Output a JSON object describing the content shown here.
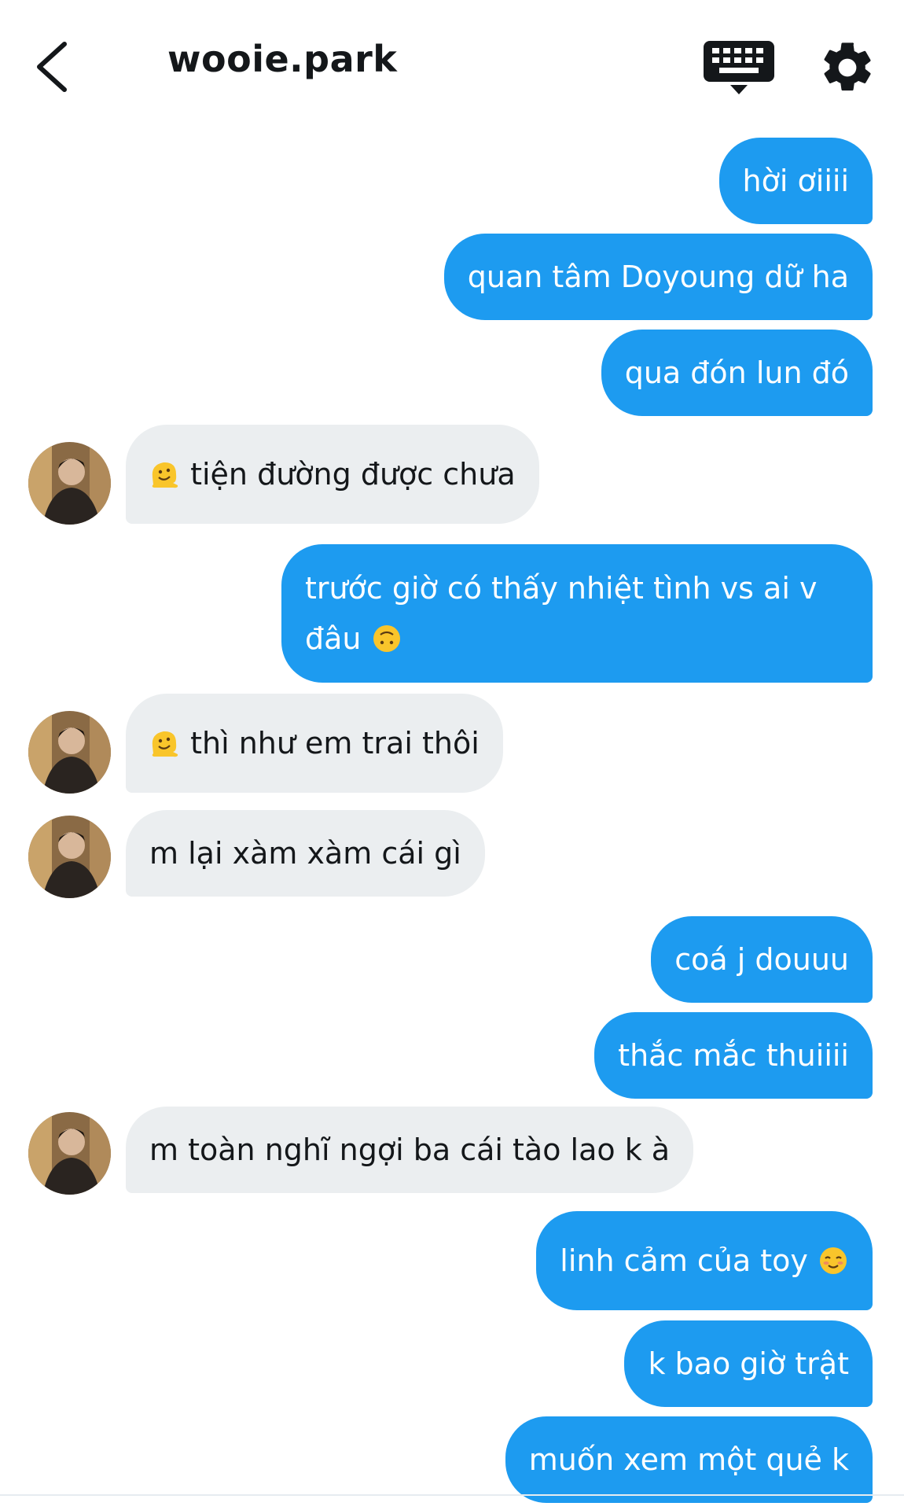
{
  "header": {
    "title": "wooie.park",
    "back_icon": "chevron-left-icon",
    "keyboard_icon": "keyboard-icon",
    "settings_icon": "gear-icon"
  },
  "colors": {
    "outgoing": "#1d9bf0",
    "incoming": "#ebeef0"
  },
  "messages": [
    {
      "dir": "out",
      "text": "hời ơiiii"
    },
    {
      "dir": "out",
      "text": "quan tâm Doyoung dữ ha"
    },
    {
      "dir": "out",
      "text": "qua đón lun đó"
    },
    {
      "dir": "in",
      "text": "tiện đường được chưa",
      "emoji": "melting-face-emoji"
    },
    {
      "dir": "out",
      "text": "trước giờ có thấy nhiệt tình vs ai v",
      "text2": "đâu",
      "emoji": "upside-down-face-emoji"
    },
    {
      "dir": "in",
      "text": "thì như em trai thôi",
      "emoji": "melting-face-emoji"
    },
    {
      "dir": "in",
      "text": "m lại xàm xàm cái gì"
    },
    {
      "dir": "out",
      "text": "coá j douuu"
    },
    {
      "dir": "out",
      "text": "thắc mắc thuiiii"
    },
    {
      "dir": "in",
      "text": "m toàn nghĩ ngợi ba cái tào lao k à"
    },
    {
      "dir": "out",
      "text": "linh cảm của toy",
      "emoji": "smiling-face-emoji"
    },
    {
      "dir": "out",
      "text": "k bao giờ trật"
    },
    {
      "dir": "out",
      "text": "muốn xem một quẻ k"
    }
  ]
}
